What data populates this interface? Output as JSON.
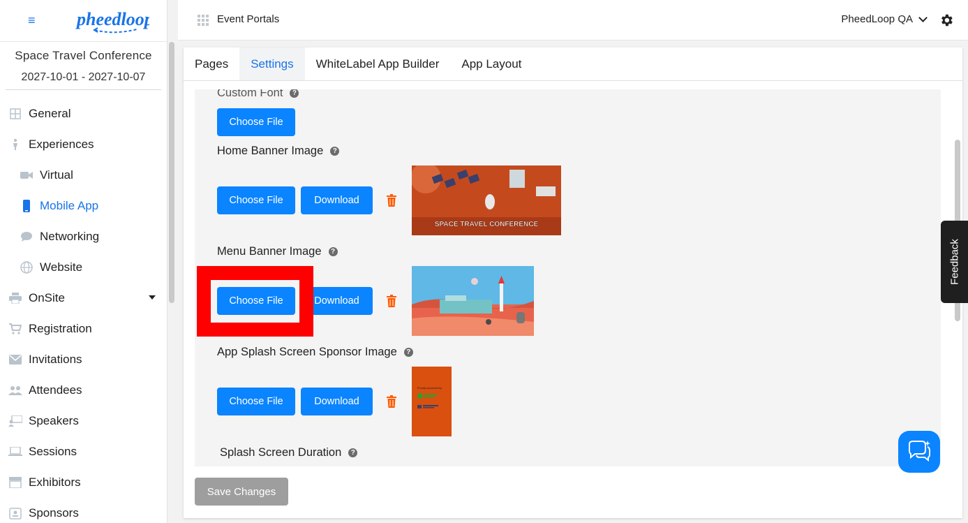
{
  "sidebar": {
    "event_name": "Space Travel Conference",
    "event_dates": "2027-10-01 - 2027-10-07",
    "items": [
      {
        "label": "General",
        "icon": "grid-icon"
      },
      {
        "label": "Experiences",
        "icon": "person-icon"
      },
      {
        "label": "Virtual",
        "icon": "video-icon"
      },
      {
        "label": "Mobile App",
        "icon": "phone-icon"
      },
      {
        "label": "Networking",
        "icon": "chat-bubble-icon"
      },
      {
        "label": "Website",
        "icon": "globe-icon"
      },
      {
        "label": "OnSite",
        "icon": "printer-icon"
      },
      {
        "label": "Registration",
        "icon": "cart-icon"
      },
      {
        "label": "Invitations",
        "icon": "envelope-icon"
      },
      {
        "label": "Attendees",
        "icon": "people-icon"
      },
      {
        "label": "Speakers",
        "icon": "presenter-icon"
      },
      {
        "label": "Sessions",
        "icon": "laptop-icon"
      },
      {
        "label": "Exhibitors",
        "icon": "storefront-icon"
      },
      {
        "label": "Sponsors",
        "icon": "badge-icon"
      }
    ],
    "active_color": "#1a73e8"
  },
  "topbar": {
    "portal_title": "Event Portals",
    "account_name": "PheedLoop QA"
  },
  "tabs": [
    {
      "label": "Pages"
    },
    {
      "label": "Settings"
    },
    {
      "label": "WhiteLabel App Builder"
    },
    {
      "label": "App Layout"
    }
  ],
  "settings": {
    "custom_font_label": "Custom Font",
    "home_banner_label": "Home Banner Image",
    "menu_banner_label": "Menu Banner Image",
    "splash_sponsor_label": "App Splash Screen Sponsor Image",
    "splash_duration_label": "Splash Screen Duration",
    "choose_file_label": "Choose File",
    "download_label": "Download",
    "home_banner_text": "SPACE TRAVEL CONFERENCE",
    "sponsor_text_1": "Proudly sponsored by"
  },
  "save_label": "Save Changes",
  "feedback_label": "Feedback",
  "colors": {
    "primary": "#0a84ff",
    "trash": "#ff5a00",
    "highlight": "#ff0000"
  }
}
